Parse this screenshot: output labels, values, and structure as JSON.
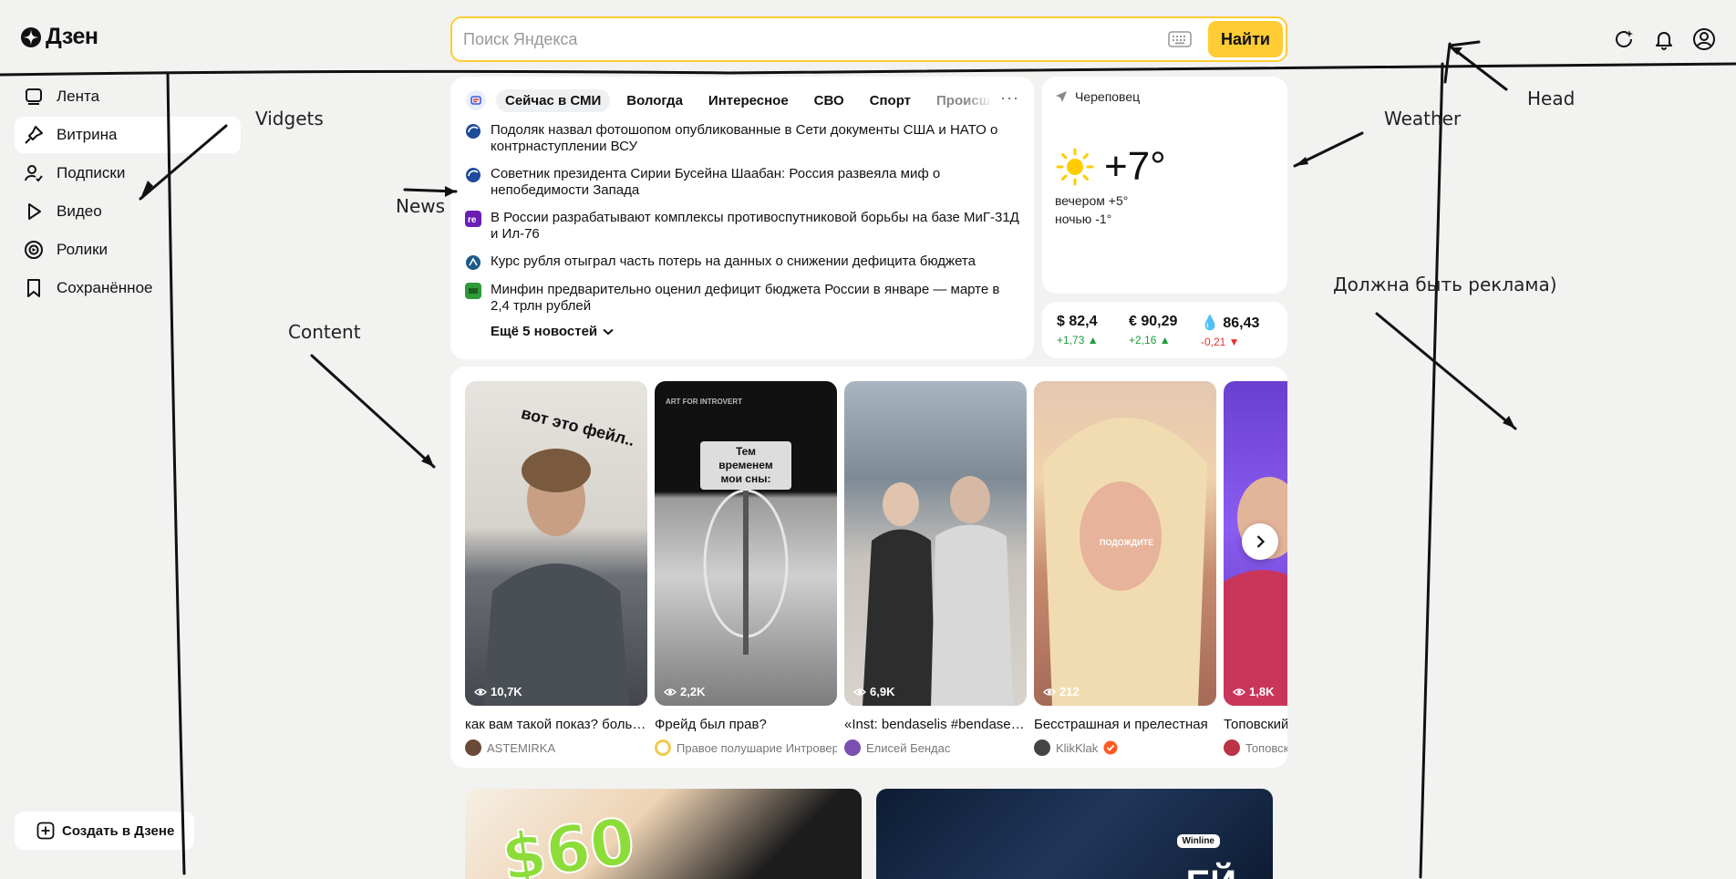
{
  "header": {
    "logo_text": "Дзен",
    "search_placeholder": "Поиск Яндекса",
    "search_button": "Найти",
    "icons": [
      "ai-sparkle-icon",
      "bell-icon",
      "profile-icon"
    ]
  },
  "sidebar": {
    "items": [
      {
        "label": "Лента",
        "icon": "feed-icon",
        "active": false
      },
      {
        "label": "Витрина",
        "icon": "showcase-icon",
        "active": true
      },
      {
        "label": "Подписки",
        "icon": "subscriptions-icon",
        "active": false
      },
      {
        "label": "Видео",
        "icon": "play-icon",
        "active": false
      },
      {
        "label": "Ролики",
        "icon": "clips-icon",
        "active": false
      },
      {
        "label": "Сохранённое",
        "icon": "bookmark-icon",
        "active": false
      }
    ],
    "create_button": "Создать в Дзене"
  },
  "news": {
    "tabs": [
      "Сейчас в СМИ",
      "Вологда",
      "Интересное",
      "СВО",
      "Спорт",
      "Происшествия"
    ],
    "active_tab": 0,
    "items": [
      {
        "text": "Подоляк назвал фотошопом опубликованные в Сети документы США и НАТО о контрнаступлении ВСУ",
        "source_color": "#1e4b9a"
      },
      {
        "text": "Советник президента Сирии Бусейна Шаабан: Россия развеяла миф о непобедимости Запада",
        "source_color": "#1e4b9a"
      },
      {
        "text": "В России разрабатывают комплексы противоспутниковой борьбы на базе МиГ-31Д и Ил-76",
        "source_color": "#6a1fb5"
      },
      {
        "text": "Курс рубля отыграл часть потерь на данных о снижении дефицита бюджета",
        "source_color": "#1c5a8a"
      },
      {
        "text": "Минфин предварительно оценил дефицит бюджета России в январе — марте в 2,4 трлн рублей",
        "source_color": "#2e9a3a"
      }
    ],
    "more_label": "Ещё 5 новостей"
  },
  "weather": {
    "city": "Череповец",
    "temp": "+7°",
    "evening": "вечером +5°",
    "night": "ночью -1°"
  },
  "rates": [
    {
      "value": "$ 82,4",
      "delta": "+1,73 ▲",
      "trend": "up"
    },
    {
      "value": "€ 90,29",
      "delta": "+2,16 ▲",
      "trend": "up"
    },
    {
      "value": "💧 86,43",
      "delta": "-0,21 ▼",
      "trend": "down"
    }
  ],
  "carousel": {
    "cards": [
      {
        "views": "10,7K",
        "title": "как вам такой показ? больше",
        "author": "ASTEMIRKA",
        "overlay": "вот это фейл..",
        "verified": false,
        "ava": "#6b4a3a"
      },
      {
        "views": "2,2K",
        "title": "Фрейд был прав?",
        "author": "Правое полушарие Интроверта",
        "overlay": "Тем временем мои сны:",
        "corner": "ART FOR INTROVERT",
        "verified": false,
        "ava": "#f2c94c"
      },
      {
        "views": "6,9K",
        "title": "«Inst: bendaselis #bendaselis»",
        "author": "Елисей Бендас",
        "verified": false,
        "ava": "#7a4fb0"
      },
      {
        "views": "212",
        "title": "Бесстрашная и прелестная",
        "author": "KlikKlak",
        "overlay": "ПОДОЖДИТЕ",
        "verified": true,
        "ava": "#444"
      },
      {
        "views": "1,8K",
        "title": "Топовский",
        "author": "Топовский",
        "verified": false,
        "ava": "#b34"
      }
    ]
  },
  "promo": {
    "tile1_text": "$60",
    "tile2_brand": "Winline",
    "tile2_text": "ЕЙ"
  },
  "annotations": {
    "head": "Head",
    "vidgets": "Vidgets",
    "news": "News",
    "weather": "Weather",
    "content": "Content",
    "ads": "Должна быть реклама)"
  }
}
